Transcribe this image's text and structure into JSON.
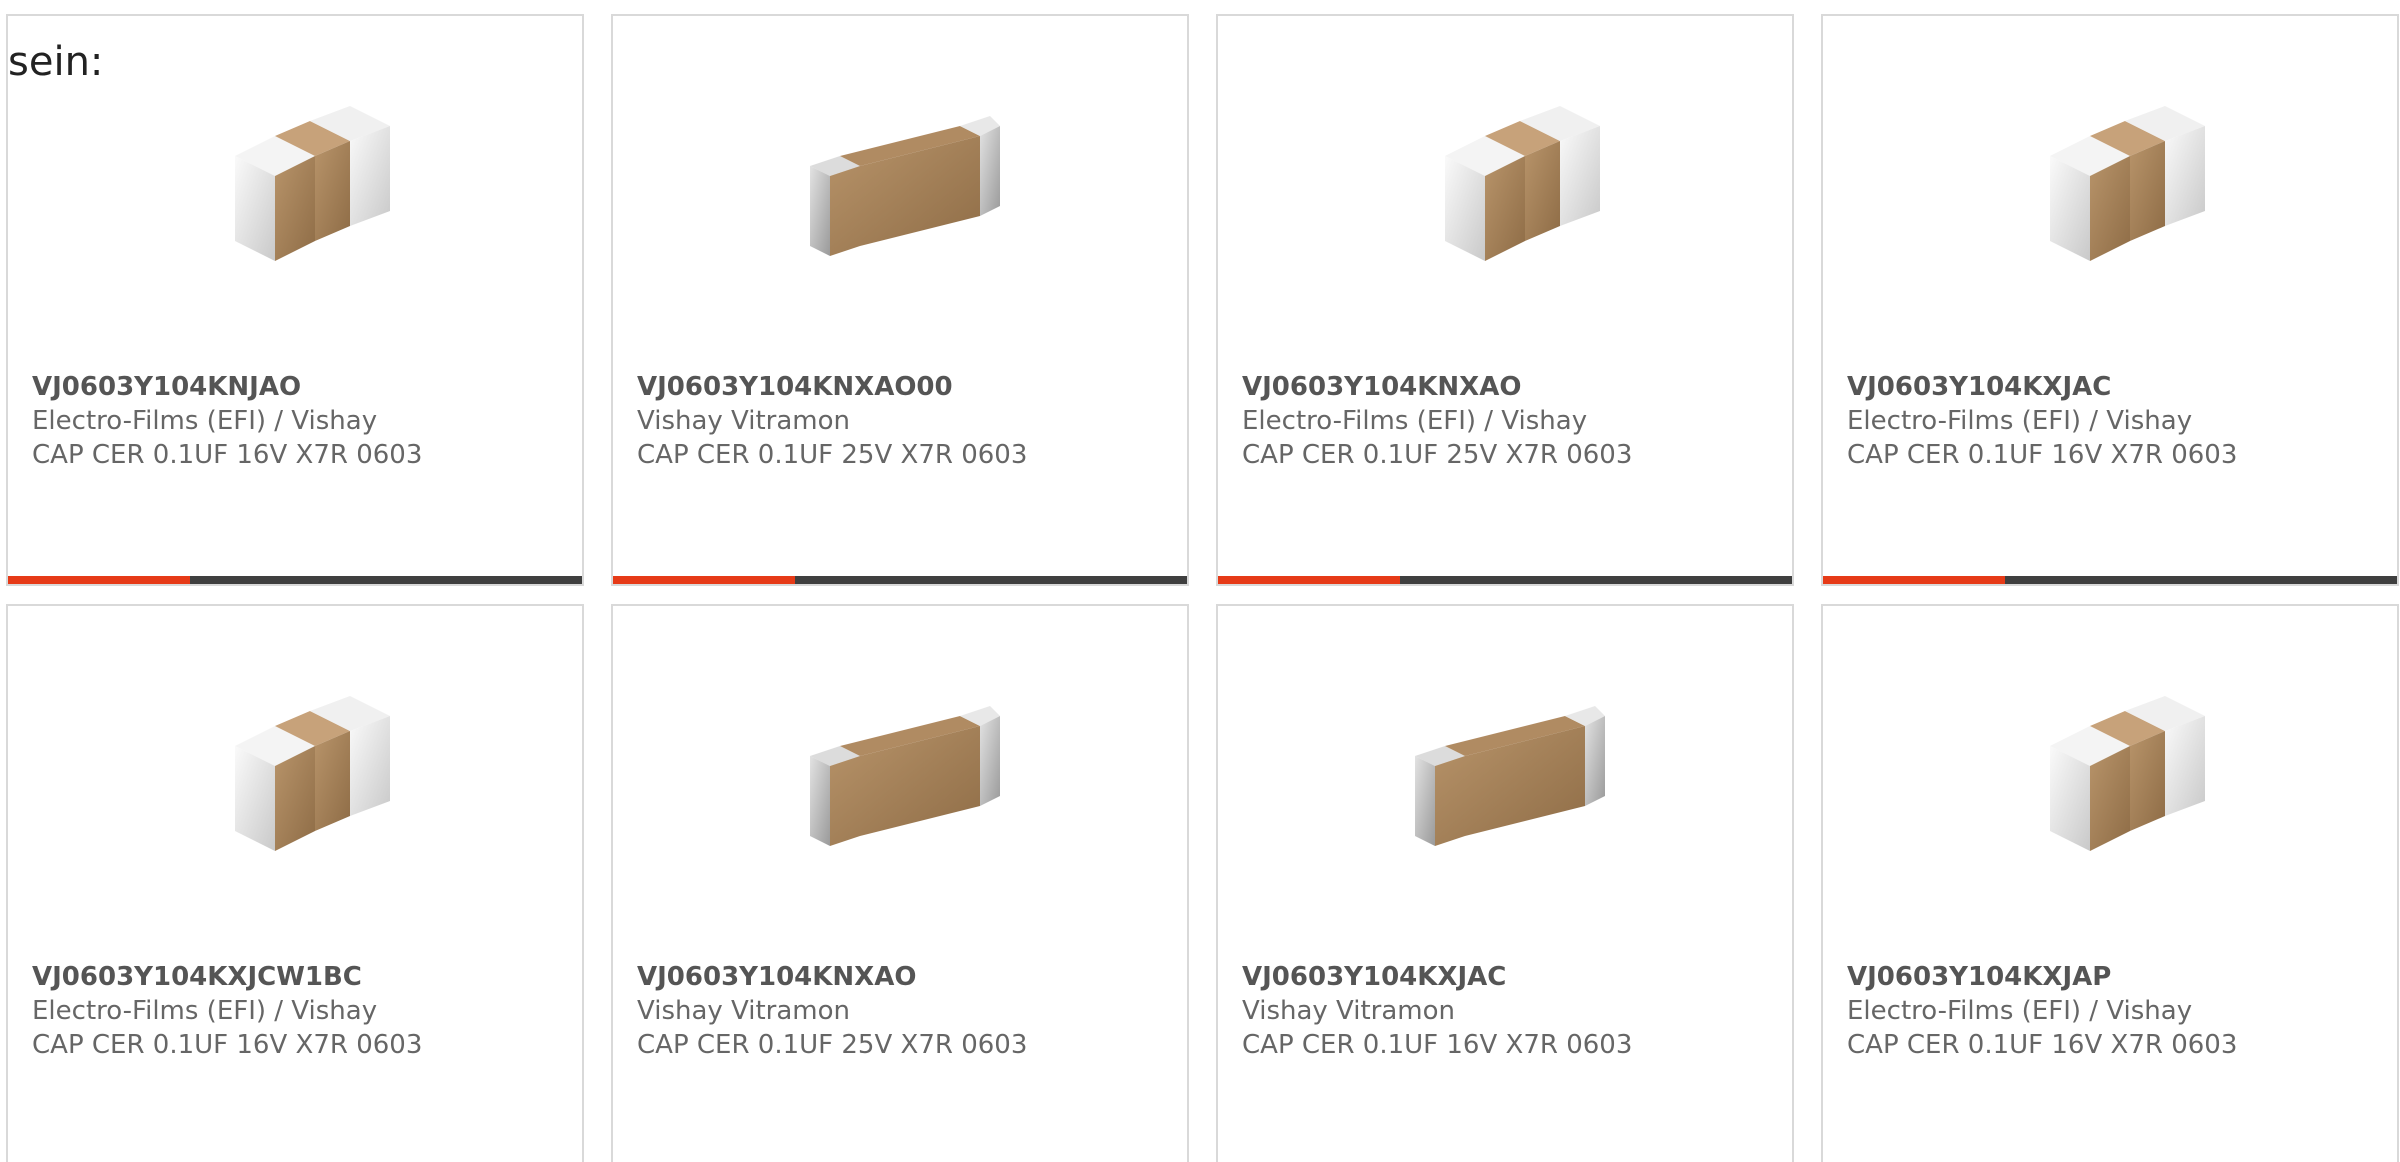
{
  "intro_text": "sein:",
  "colors": {
    "accent_bar": "#e63a17",
    "bar": "#3f3f3f",
    "card_border": "#d9d9d9"
  },
  "products": [
    {
      "part_number": "VJ0603Y104KNJAO",
      "manufacturer": "Electro-Films (EFI) / Vishay",
      "description": "CAP CER 0.1UF 16V X7R 0603",
      "image": "capacitor-small-icon"
    },
    {
      "part_number": "VJ0603Y104KNXAO00",
      "manufacturer": "Vishay Vitramon",
      "description": "CAP CER 0.1UF 25V X7R 0603",
      "image": "capacitor-large-icon"
    },
    {
      "part_number": "VJ0603Y104KNXAO",
      "manufacturer": "Electro-Films (EFI) / Vishay",
      "description": "CAP CER 0.1UF 25V X7R 0603",
      "image": "capacitor-small-icon"
    },
    {
      "part_number": "VJ0603Y104KXJAC",
      "manufacturer": "Electro-Films (EFI) / Vishay",
      "description": "CAP CER 0.1UF 16V X7R 0603",
      "image": "capacitor-small-icon"
    },
    {
      "part_number": "VJ0603Y104KXJCW1BC",
      "manufacturer": "Electro-Films (EFI) / Vishay",
      "description": "CAP CER 0.1UF 16V X7R 0603",
      "image": "capacitor-small-icon"
    },
    {
      "part_number": "VJ0603Y104KNXAO",
      "manufacturer": "Vishay Vitramon",
      "description": "CAP CER 0.1UF 25V X7R 0603",
      "image": "capacitor-large-icon"
    },
    {
      "part_number": "VJ0603Y104KXJAC",
      "manufacturer": "Vishay Vitramon",
      "description": "CAP CER 0.1UF 16V X7R 0603",
      "image": "capacitor-large-icon"
    },
    {
      "part_number": "VJ0603Y104KXJAP",
      "manufacturer": "Electro-Films (EFI) / Vishay",
      "description": "CAP CER 0.1UF 16V X7R 0603",
      "image": "capacitor-small-icon"
    }
  ]
}
